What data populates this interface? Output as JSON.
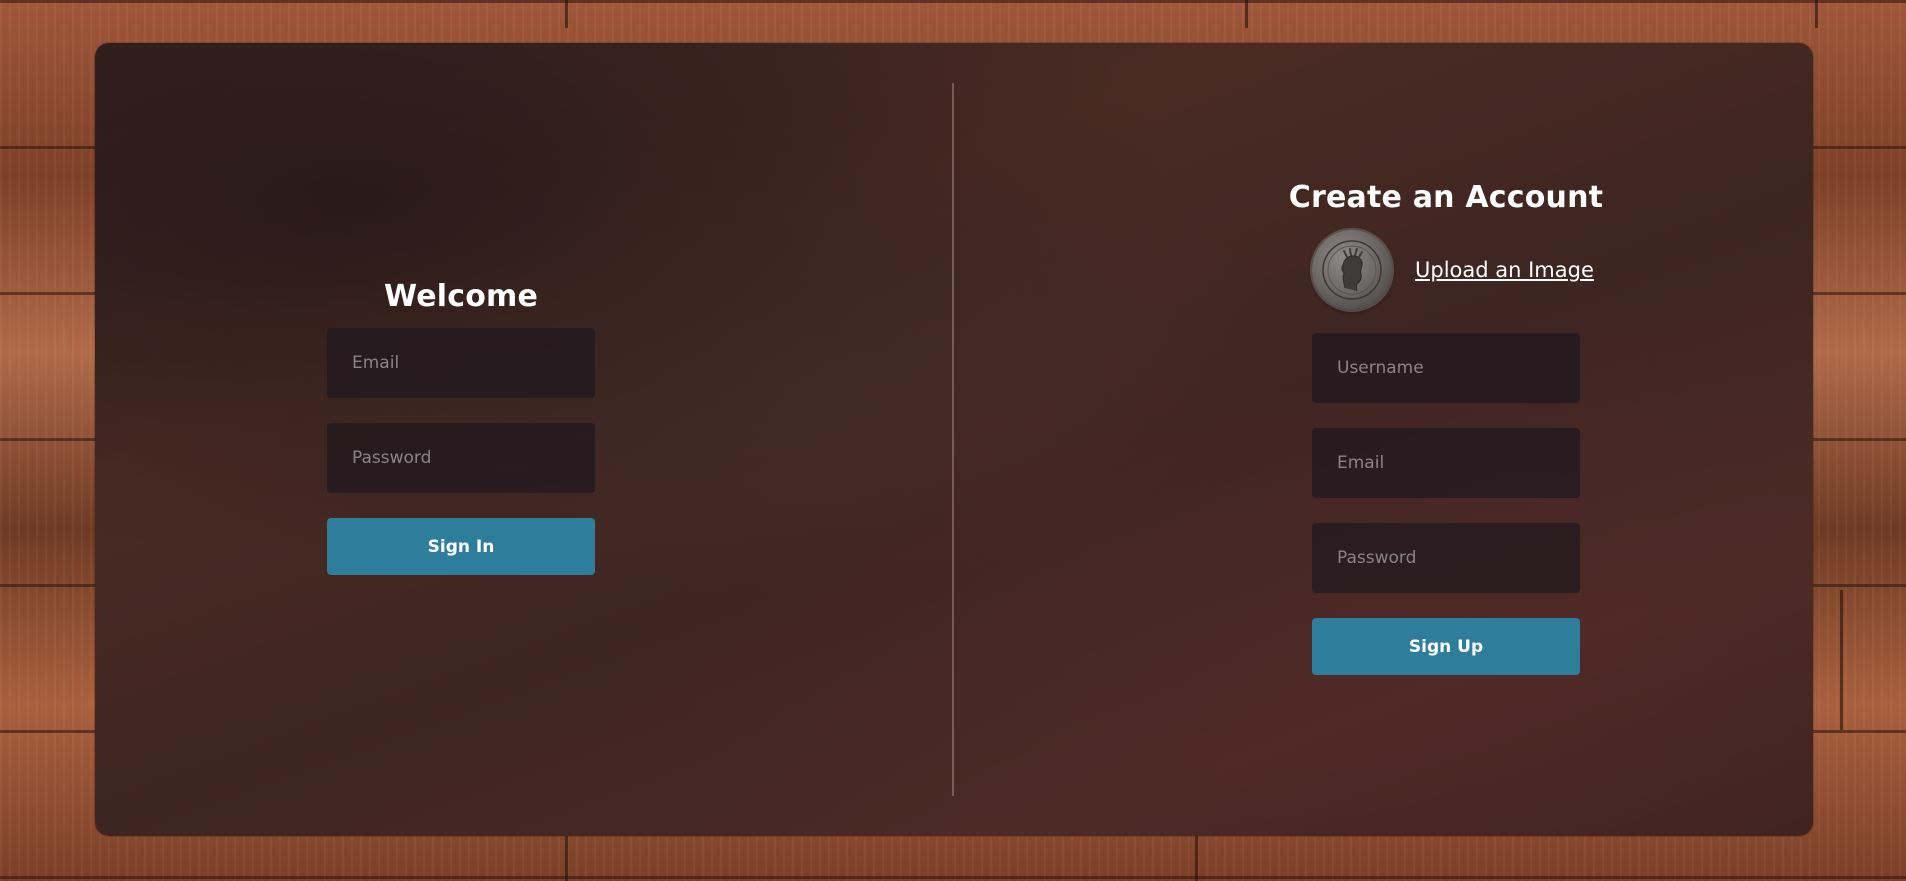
{
  "signin": {
    "title": "Welcome",
    "email_placeholder": "Email",
    "password_placeholder": "Password",
    "button_label": "Sign In"
  },
  "signup": {
    "title": "Create an Account",
    "avatar_icon": "coin-avatar-icon",
    "upload_label": "Upload an Image",
    "username_placeholder": "Username",
    "email_placeholder": "Email",
    "password_placeholder": "Password",
    "button_label": "Sign Up"
  },
  "colors": {
    "panel": "#3f2623",
    "field": "#241e25",
    "button": "#2e7e9b",
    "text": "#ffffff",
    "placeholder": "#8b8386"
  }
}
